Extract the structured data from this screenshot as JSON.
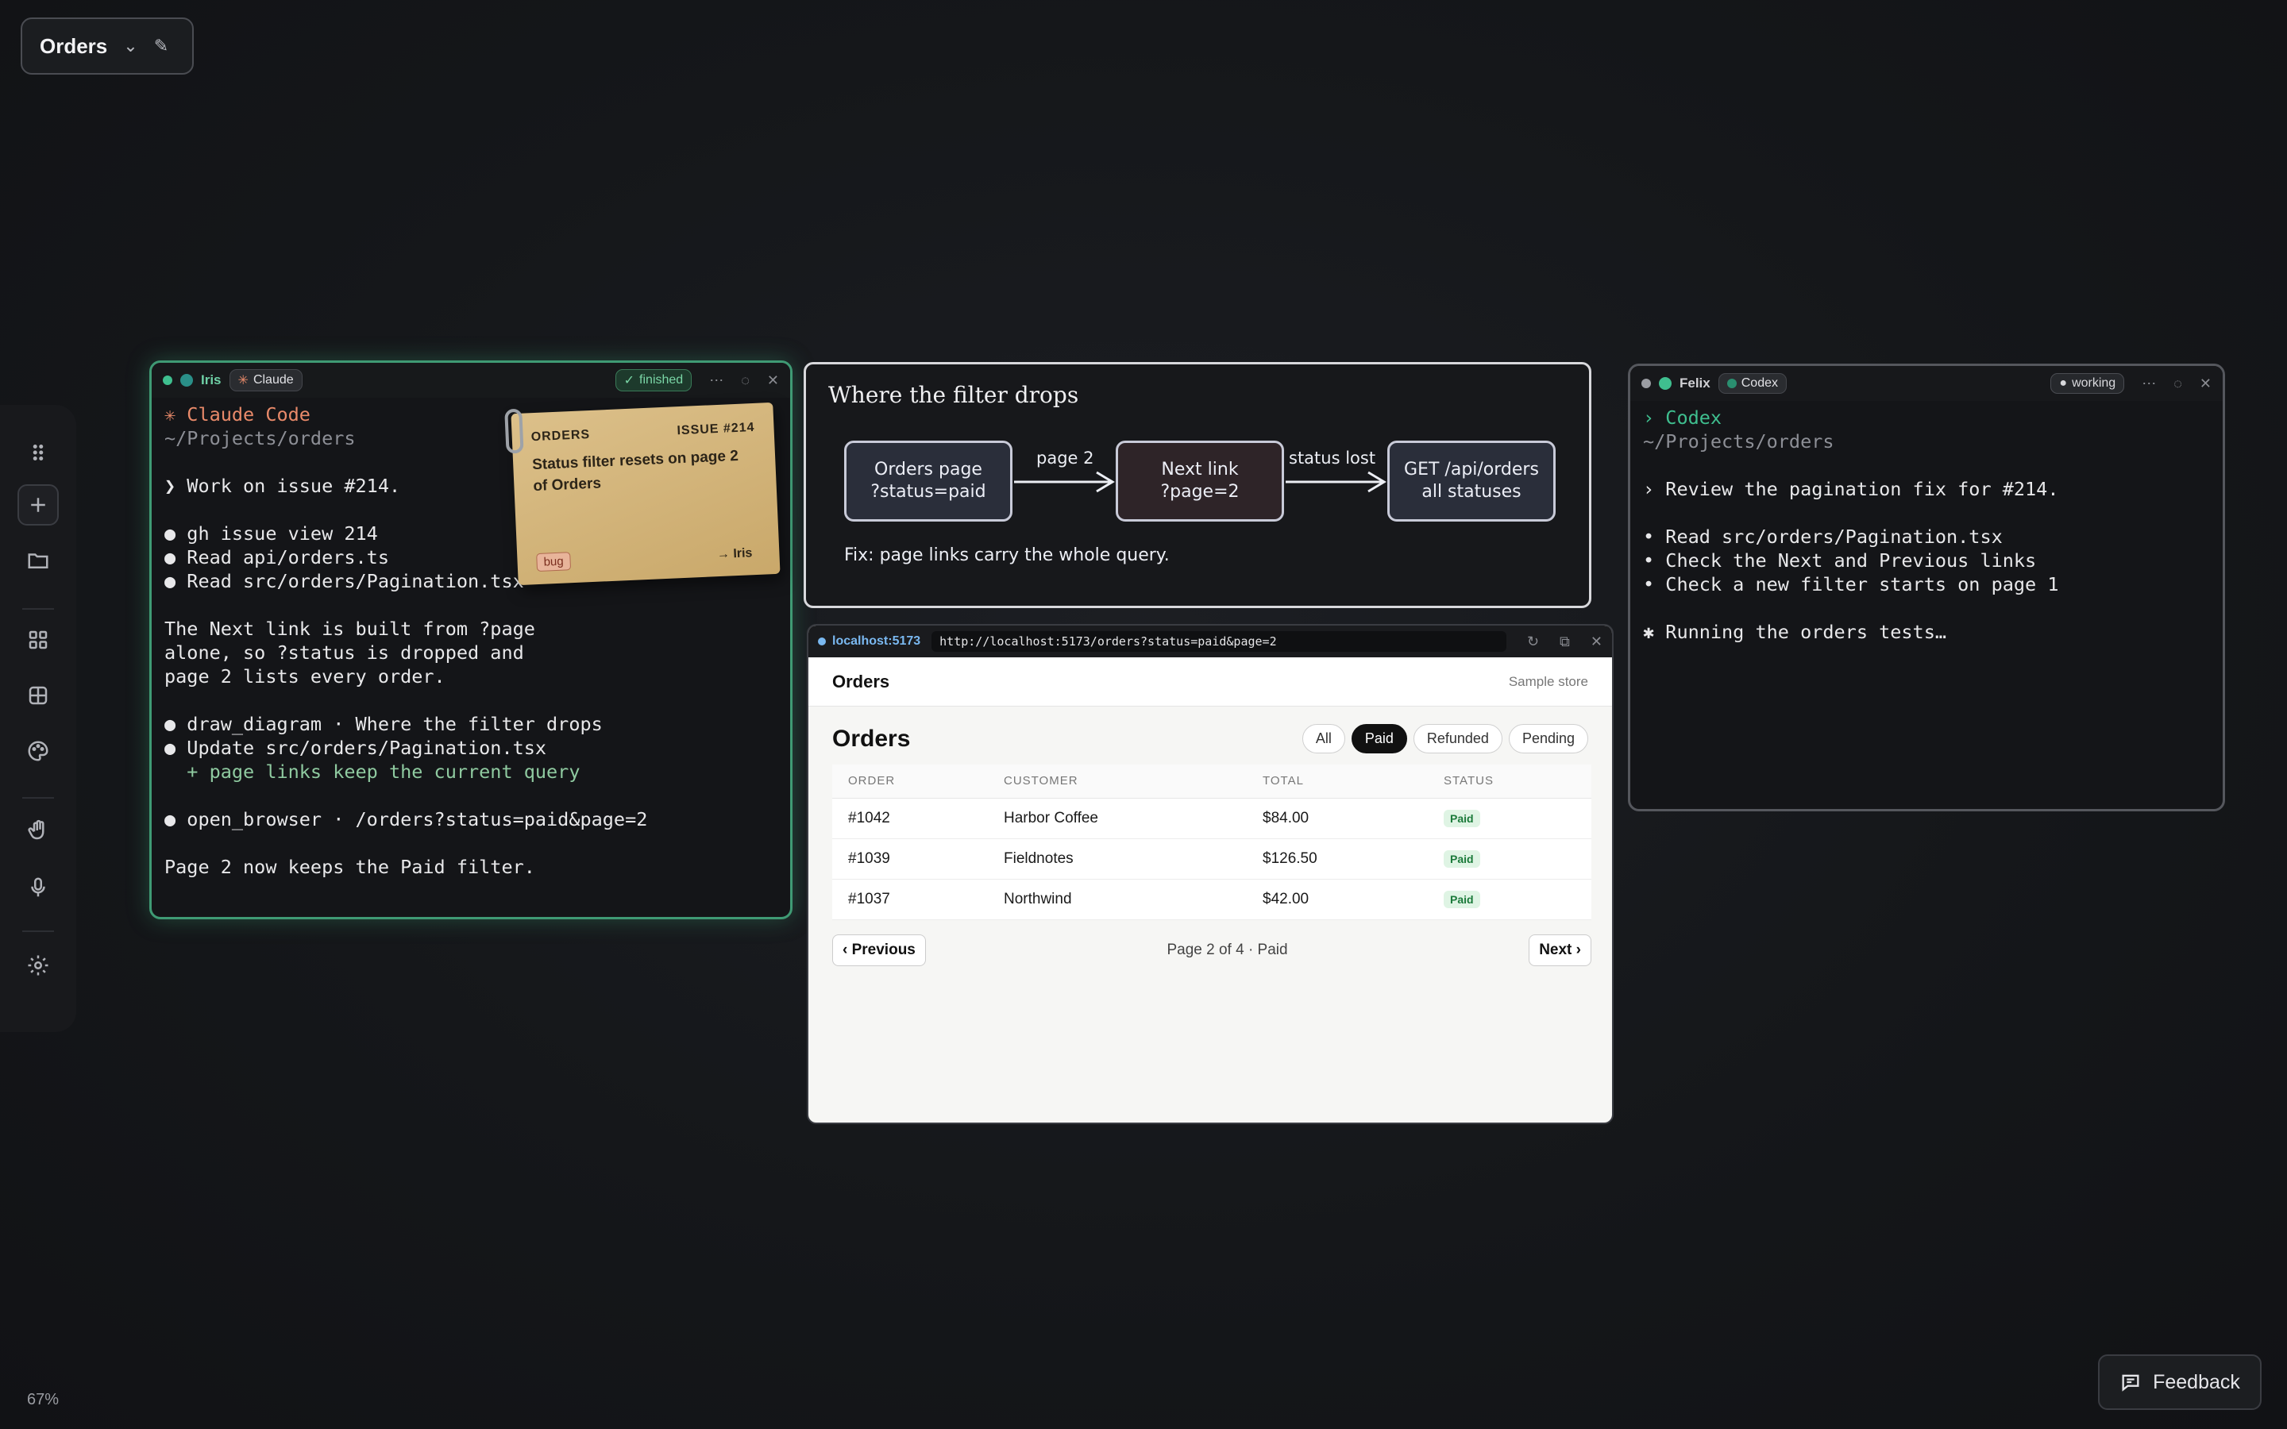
{
  "workspace": {
    "title": "Orders"
  },
  "zoom": "67%",
  "feedback": "Feedback",
  "claude_window": {
    "agent": "Iris",
    "tool": "Claude",
    "status": "finished",
    "lines": [
      {
        "t": "✳ Claude Code",
        "c": "#e98a6a"
      },
      {
        "t": "~/Projects/orders",
        "c": "#8d8f96"
      },
      {
        "t": "",
        "c": "#e8e8ea"
      },
      {
        "t": "❯ Work on issue #214.",
        "c": "#e8e8ea"
      },
      {
        "t": "",
        "c": "#e8e8ea"
      },
      {
        "t": "● gh issue view 214",
        "c": "#e8e8ea"
      },
      {
        "t": "● Read api/orders.ts",
        "c": "#e8e8ea"
      },
      {
        "t": "● Read src/orders/Pagination.tsx",
        "c": "#e8e8ea"
      },
      {
        "t": "",
        "c": "#e8e8ea"
      },
      {
        "t": "The Next link is built from ?page",
        "c": "#e8e8ea"
      },
      {
        "t": "alone, so ?status is dropped and",
        "c": "#e8e8ea"
      },
      {
        "t": "page 2 lists every order.",
        "c": "#e8e8ea"
      },
      {
        "t": "",
        "c": "#e8e8ea"
      },
      {
        "t": "● draw_diagram · Where the filter drops",
        "c": "#e8e8ea"
      },
      {
        "t": "● Update src/orders/Pagination.tsx",
        "c": "#e8e8ea"
      },
      {
        "t": "  + page links keep the current query",
        "c": "#8fcaa0"
      },
      {
        "t": "",
        "c": "#e8e8ea"
      },
      {
        "t": "● open_browser · /orders?status=paid&page=2",
        "c": "#e8e8ea"
      },
      {
        "t": "",
        "c": "#e8e8ea"
      },
      {
        "t": "Page 2 now keeps the Paid filter.",
        "c": "#e8e8ea"
      }
    ]
  },
  "sticky_note": {
    "project": "ORDERS",
    "issue": "ISSUE #214",
    "text": "Status filter resets on page 2 of Orders",
    "tag": "bug",
    "assignee": "→ Iris"
  },
  "diagram": {
    "title": "Where the filter drops",
    "nodes": [
      "Orders page\n?status=paid",
      "Next link\n?page=2",
      "GET /api/orders\nall statuses"
    ],
    "edges": [
      "page 2",
      "status lost"
    ],
    "note": "Fix: page links carry the whole query."
  },
  "browser": {
    "host": "localhost:5173",
    "url": "http://localhost:5173/orders?status=paid&page=2",
    "nav_title": "Orders",
    "store": "Sample store",
    "heading": "Orders",
    "filters": [
      {
        "label": "All",
        "active": false
      },
      {
        "label": "Paid",
        "active": true
      },
      {
        "label": "Refunded",
        "active": false
      },
      {
        "label": "Pending",
        "active": false
      }
    ],
    "columns": [
      "ORDER",
      "CUSTOMER",
      "TOTAL",
      "STATUS"
    ],
    "rows": [
      [
        "#1042",
        "Harbor Coffee",
        "$84.00",
        "Paid"
      ],
      [
        "#1039",
        "Fieldnotes",
        "$126.50",
        "Paid"
      ],
      [
        "#1037",
        "Northwind",
        "$42.00",
        "Paid"
      ]
    ],
    "prev": "‹ Previous",
    "page_info": "Page 2 of 4 · Paid",
    "next": "Next ›"
  },
  "codex_window": {
    "agent": "Felix",
    "tool": "Codex",
    "status": "working",
    "lines": [
      {
        "t": "› Codex",
        "c": "#3fbf8f"
      },
      {
        "t": "~/Projects/orders",
        "c": "#8d8f96"
      },
      {
        "t": "",
        "c": "#e8e8ea"
      },
      {
        "t": "› Review the pagination fix for #214.",
        "c": "#e8e8ea"
      },
      {
        "t": "",
        "c": "#e8e8ea"
      },
      {
        "t": "• Read src/orders/Pagination.tsx",
        "c": "#e8e8ea"
      },
      {
        "t": "• Check the Next and Previous links",
        "c": "#e8e8ea"
      },
      {
        "t": "• Check a new filter starts on page 1",
        "c": "#e8e8ea"
      },
      {
        "t": "",
        "c": "#e8e8ea"
      },
      {
        "t": "✱ Running the orders tests…",
        "c": "#e8e8ea"
      }
    ]
  }
}
